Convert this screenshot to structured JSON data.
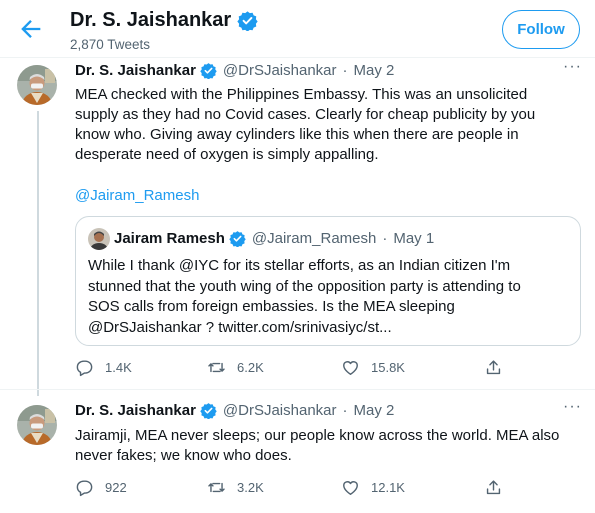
{
  "header": {
    "name": "Dr. S. Jaishankar",
    "tweet_count": "2,870 Tweets",
    "follow_label": "Follow"
  },
  "tweets": [
    {
      "name": "Dr. S. Jaishankar",
      "handle": "@DrSJaishankar",
      "sep": "·",
      "date": "May 2",
      "lines": [
        "MEA checked with the Philippines Embassy. This was an unsolicited",
        "supply as they had no Covid cases. Clearly for cheap publicity by you",
        "know who. Giving away cylinders like this when there are people in",
        "desperate need of oxygen is simply appalling."
      ],
      "mention": "@Jairam_Ramesh",
      "quote": {
        "name": "Jairam Ramesh",
        "handle": "@Jairam_Ramesh",
        "sep": "·",
        "date": "May 1",
        "lines": [
          "While I thank @IYC for its stellar efforts, as an Indian citizen I'm",
          "stunned that the youth wing of the opposition party is attending to",
          "SOS calls from foreign embassies. Is the MEA sleeping",
          "@DrSJaishankar ? twitter.com/srinivasiyc/st..."
        ]
      },
      "replies": "1.4K",
      "retweets": "6.2K",
      "likes": "15.8K"
    },
    {
      "name": "Dr. S. Jaishankar",
      "handle": "@DrSJaishankar",
      "sep": "·",
      "date": "May 2",
      "lines": [
        "Jairamji, MEA never sleeps; our people know across the world. MEA also",
        "never fakes; we know who does."
      ],
      "replies": "922",
      "retweets": "3.2K",
      "likes": "12.1K"
    }
  ],
  "icons": {
    "back": "arrow-left-icon",
    "verified": "verified-badge-icon",
    "more": "more-icon",
    "reply": "reply-icon",
    "retweet": "retweet-icon",
    "like": "heart-icon",
    "share": "share-icon"
  },
  "colors": {
    "accent": "#1d9bf0",
    "text": "#0f1419",
    "muted": "#536471",
    "border": "#cfd9de"
  }
}
